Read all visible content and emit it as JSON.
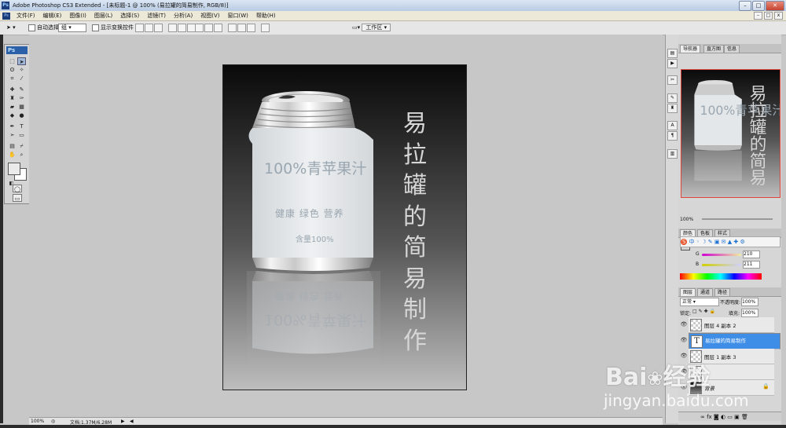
{
  "app": {
    "window_title": "Adobe Photoshop CS3 Extended - [未标题-1 @ 100% (易拉罐的简易制作, RGB/8)]",
    "ps_logo": "Ps"
  },
  "menu": [
    "文件(F)",
    "编辑(E)",
    "图像(I)",
    "图层(L)",
    "选择(S)",
    "滤镜(T)",
    "分析(A)",
    "视图(V)",
    "窗口(W)",
    "帮助(H)"
  ],
  "options_bar": {
    "auto_select_label": "自动选择:",
    "auto_select_value": "组",
    "show_transform_label": "显示变换控件",
    "workspace_label": "工作区"
  },
  "canvas": {
    "can_main_text": "100%青苹果汁",
    "can_sub_text": "健康  绿色  营养",
    "can_content_text": "含量100%",
    "vertical_title": [
      "易",
      "拉",
      "罐",
      "的",
      "简",
      "易",
      "制",
      "作"
    ]
  },
  "status": {
    "zoom": "100%",
    "doc_info": "文档:1.37M/6.28M"
  },
  "navigator": {
    "tabs": [
      "导航器",
      "直方图",
      "信息"
    ],
    "zoom": "100%"
  },
  "color_panel": {
    "tabs": [
      "颜色",
      "色板",
      "样式"
    ],
    "labels": [
      "R",
      "G",
      "B"
    ],
    "values": [
      "",
      "210",
      "211"
    ]
  },
  "layers_panel": {
    "tabs": [
      "图层",
      "通道",
      "路径"
    ],
    "blend_mode": "正常",
    "opacity_label": "不透明度:",
    "opacity_value": "100%",
    "lock_label": "锁定:",
    "fill_label": "填充:",
    "fill_value": "100%",
    "layers": [
      {
        "name": "图层 4 副本 2",
        "type": "pixel",
        "selected": false
      },
      {
        "name": "易拉罐的简易制作",
        "type": "text",
        "selected": true
      },
      {
        "name": "图层 1 副本 3",
        "type": "pixel",
        "selected": false
      },
      {
        "name": "",
        "type": "pixel",
        "selected": false
      },
      {
        "name": "背景",
        "type": "background",
        "selected": false
      }
    ]
  },
  "watermark": {
    "brand": "Bai",
    "brand2": "经验",
    "url": "jingyan.baidu.com"
  }
}
